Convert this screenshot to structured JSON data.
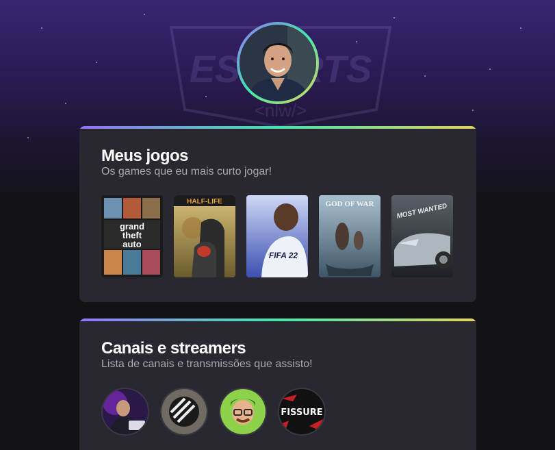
{
  "background": {
    "logo_text": "ESPORTS",
    "logo_sub": "<nlw/>"
  },
  "profile": {
    "avatar_icon": "user-photo"
  },
  "games_section": {
    "title": "Meus jogos",
    "subtitle": "Os games que eu mais curto jogar!",
    "games": [
      {
        "name": "gta-v",
        "cover_lines": [
          "grand",
          "theft",
          "auto"
        ],
        "accent": "#e9a23b"
      },
      {
        "name": "counter-strike",
        "cover_text": "HALF-LIFE",
        "accent": "#c9a85a"
      },
      {
        "name": "fifa-22",
        "cover_text": "FIFA 22",
        "accent": "#5b7bd6"
      },
      {
        "name": "god-of-war",
        "cover_text": "GOD OF WAR",
        "accent": "#6d8aa0"
      },
      {
        "name": "need-for-speed-most-wanted",
        "cover_text": "MOST WANTED",
        "accent": "#9aa3ad"
      }
    ]
  },
  "streamers_section": {
    "title": "Canais e streamers",
    "subtitle": "Lista de canais e transmissões que assisto!",
    "streamers": [
      {
        "name": "streamer-1"
      },
      {
        "name": "streamer-2"
      },
      {
        "name": "streamer-3"
      },
      {
        "name": "fissure",
        "label": "FISSURE"
      }
    ]
  },
  "colors": {
    "page_bg": "#121214",
    "card_bg": "#29272f",
    "title": "#ffffff",
    "subtitle": "#a8a8b3",
    "gradient_start": "#9572fc",
    "gradient_mid": "#43e7ad",
    "gradient_end": "#e2d45c"
  }
}
